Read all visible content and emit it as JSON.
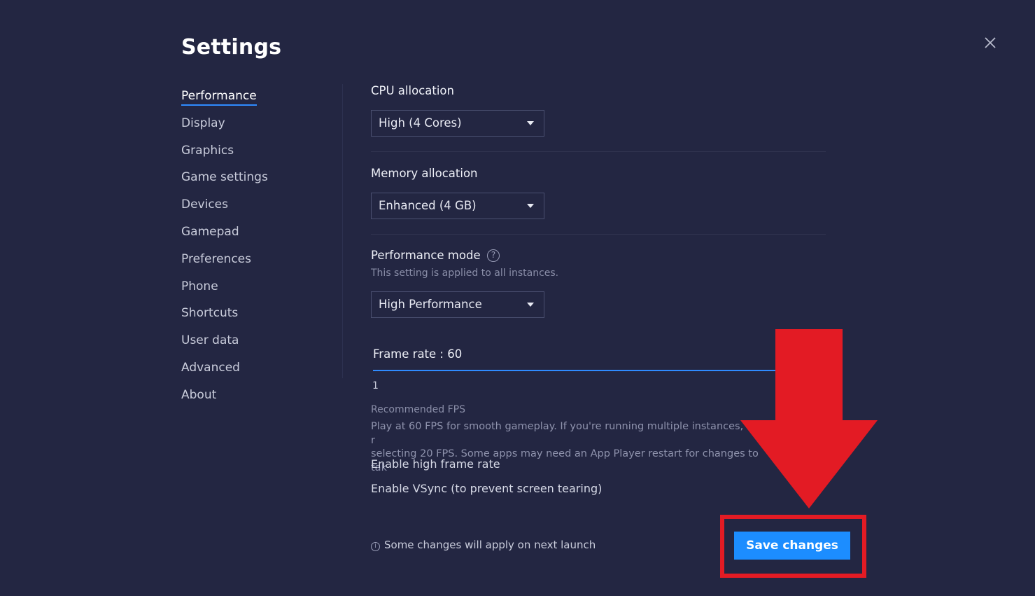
{
  "window": {
    "title": "Settings",
    "close_icon": "close-icon"
  },
  "sidebar": {
    "items": [
      {
        "label": "Performance",
        "active": true
      },
      {
        "label": "Display"
      },
      {
        "label": "Graphics"
      },
      {
        "label": "Game settings"
      },
      {
        "label": "Devices"
      },
      {
        "label": "Gamepad"
      },
      {
        "label": "Preferences"
      },
      {
        "label": "Phone"
      },
      {
        "label": "Shortcuts"
      },
      {
        "label": "User data"
      },
      {
        "label": "Advanced"
      },
      {
        "label": "About"
      }
    ]
  },
  "performance": {
    "cpu": {
      "label": "CPU allocation",
      "value": "High (4 Cores)"
    },
    "memory": {
      "label": "Memory allocation",
      "value": "Enhanced (4 GB)"
    },
    "mode": {
      "label": "Performance mode",
      "sublabel": "This setting is applied to all instances.",
      "value": "High Performance",
      "help_icon": "help-icon",
      "help_glyph": "?"
    },
    "frame_rate": {
      "label": "Frame rate : 60",
      "min_label": "1",
      "recommended_title": "Recommended FPS",
      "recommended_text_line1": "Play at 60 FPS for smooth gameplay. If you're running multiple instances, we r",
      "recommended_text_line2": "selecting 20 FPS. Some apps may need an App Player restart for changes to tak"
    },
    "toggles": {
      "high_frame_rate": "Enable high frame rate",
      "vsync": "Enable VSync (to prevent screen tearing)"
    }
  },
  "footer": {
    "note": "Some changes will apply on next launch",
    "info_glyph": "i",
    "save_label": "Save changes"
  },
  "colors": {
    "background": "#232642",
    "accent": "#1c8dff",
    "annotation_red": "#e31b24"
  }
}
